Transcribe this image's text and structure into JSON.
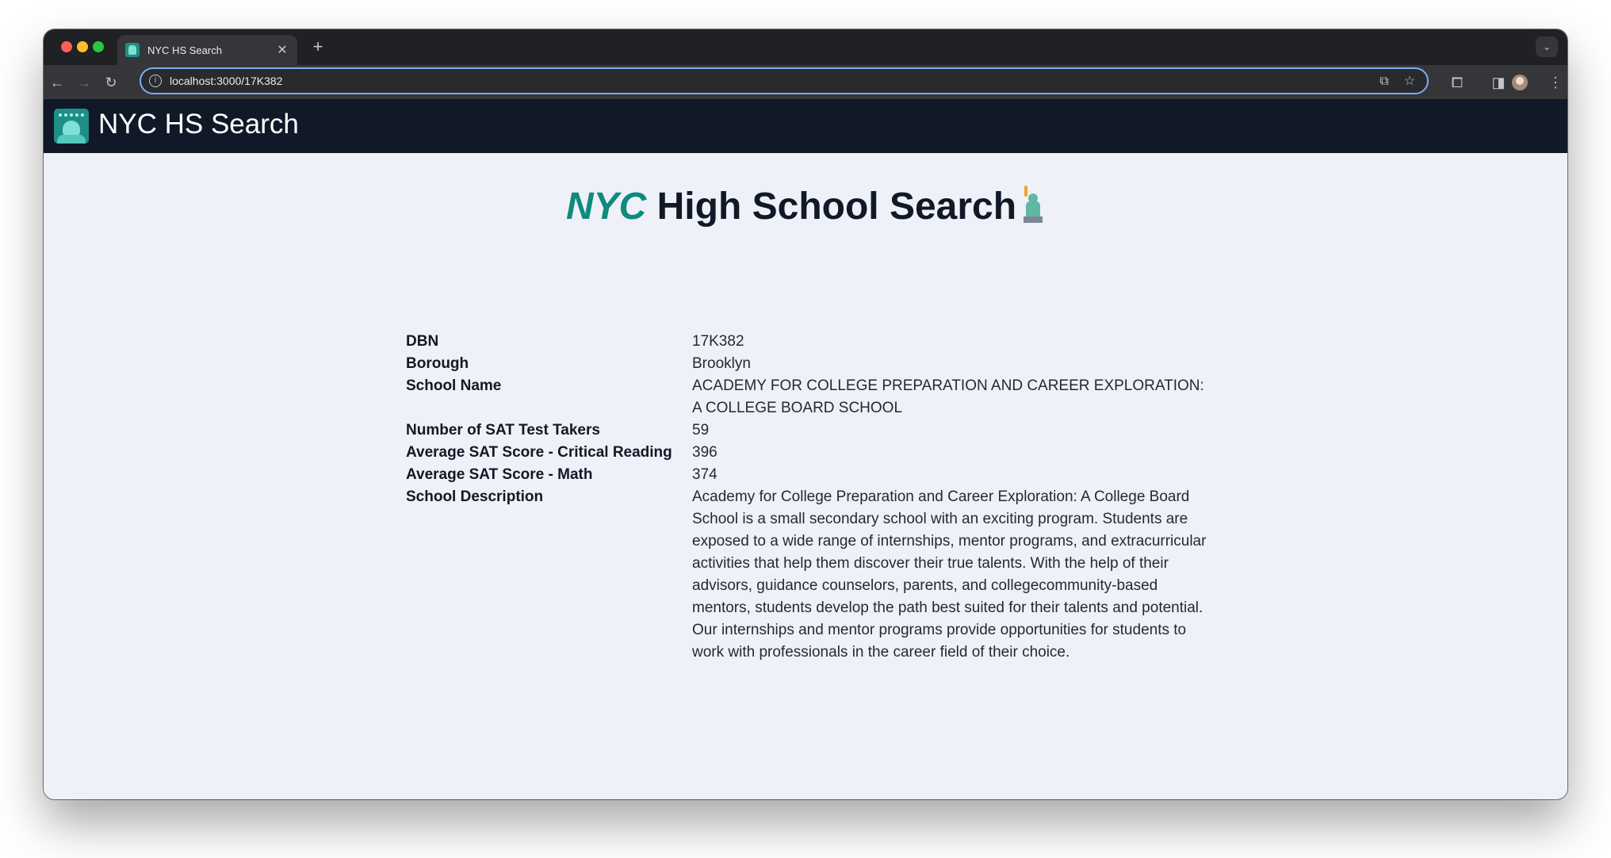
{
  "browser": {
    "tab_title": "NYC HS Search",
    "url": "localhost:3000/17K382"
  },
  "navbar": {
    "brand": "NYC HS Search"
  },
  "page": {
    "heading_highlight": "NYC",
    "heading_rest": "High School Search"
  },
  "school": {
    "rows": [
      {
        "label": "DBN",
        "value": "17K382"
      },
      {
        "label": "Borough",
        "value": "Brooklyn"
      },
      {
        "label": "School Name",
        "value": "ACADEMY FOR COLLEGE PREPARATION AND CAREER EXPLORATION: A COLLEGE BOARD SCHOOL"
      },
      {
        "label": "Number of SAT Test Takers",
        "value": "59"
      },
      {
        "label": "Average SAT Score - Critical Reading",
        "value": "396"
      },
      {
        "label": "Average SAT Score - Math",
        "value": "374"
      },
      {
        "label": "School Description",
        "value": "Academy for College Preparation and Career Exploration: A College Board School is a small secondary school with an exciting program. Students are exposed to a wide range of internships, mentor programs, and extracurricular activities that help them discover their true talents. With the help of their advisors, guidance counselors, parents, and collegecommunity-based mentors, students develop the path best suited for their talents and potential. Our internships and mentor programs provide opportunities for students to work with professionals in the career field of their choice."
      }
    ]
  },
  "colors": {
    "navbar_bg": "#111827",
    "accent": "#0f8a7e",
    "page_bg": "#eef1f7"
  },
  "icons": [
    "close-tab-icon",
    "new-tab-icon",
    "back-icon",
    "forward-icon",
    "reload-icon",
    "site-info-icon",
    "install-app-icon",
    "bookmark-star-icon",
    "extensions-icon",
    "side-panel-icon",
    "profile-avatar",
    "menu-icon",
    "statue-of-liberty-icon"
  ]
}
